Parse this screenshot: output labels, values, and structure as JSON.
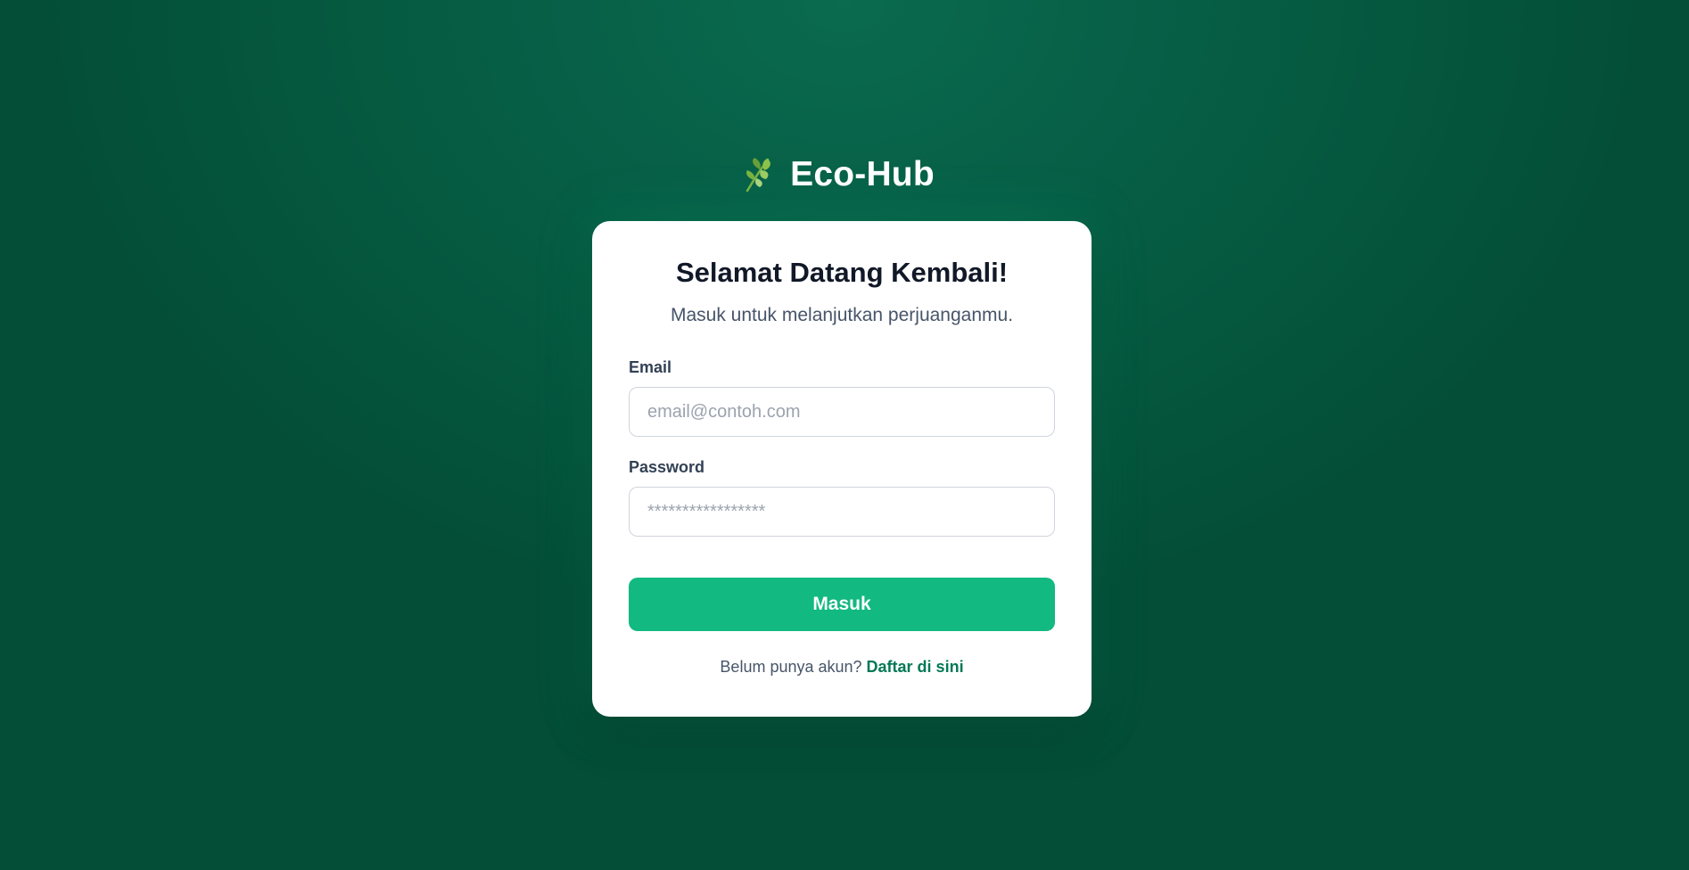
{
  "brand": {
    "icon": "leaf-sprout-icon",
    "name": "Eco-Hub"
  },
  "login": {
    "title": "Selamat Datang Kembali!",
    "subtitle": "Masuk untuk melanjutkan perjuanganmu.",
    "email_label": "Email",
    "email_placeholder": "email@contoh.com",
    "email_value": "",
    "password_label": "Password",
    "password_placeholder": "*****************",
    "password_value": "",
    "submit_label": "Masuk",
    "signup_prompt": "Belum punya akun?",
    "signup_link": "Daftar di sini"
  },
  "colors": {
    "background": "#065a41",
    "accent": "#12b981",
    "link": "#047857"
  }
}
